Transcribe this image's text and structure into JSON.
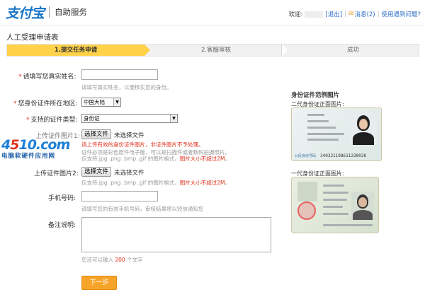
{
  "header": {
    "logo": "支付宝",
    "title": "自助服务",
    "welcome": "欢迎:",
    "logout": "[退出]",
    "messages": "消息(2)",
    "help": "使用遇到问题?"
  },
  "page": {
    "title": "人工受理申请表"
  },
  "steps": [
    {
      "label": "1.提交任务申请"
    },
    {
      "label": "2.客服审核"
    },
    {
      "label": "成功"
    }
  ],
  "form": {
    "name_label": "请填写您真实姓名:",
    "name_hint": "请填写真实姓名，以便核实您的身份。",
    "region_label": "您身份证件所在地区:",
    "region_value": "中国大陆",
    "cert_type_label": "支持的证件类型:",
    "cert_type_value": "身份证",
    "upload1_label": "上传证件图片1:",
    "upload_button": "选择文件",
    "no_file": "未选择文件",
    "upload1_hint_red": "请上传有效的身份证件图片，非证件图片不予处理。",
    "upload1_hint_2": "证件必须是彩色原件电子版，可以是扫描件或者数码拍摄照片。",
    "upload1_hint_3_prefix": "仅支持.jpg .png .bmp .gif 的图片格式，",
    "size_limit": "图片大小不超过2M",
    "upload2_label": "上传证件图片2:",
    "upload2_hint_prefix": "仅支持.jpg .png .bmp .gif 的图片格式，",
    "phone_label": "手机号码:",
    "phone_hint": "请填写您的有效手机号码，审核结果将以短信通知您",
    "remark_label": "备注说明:",
    "remark_hint_prefix": "您还可以输入",
    "remark_count": "200",
    "remark_hint_suffix": "个文字",
    "next_button": "下一步"
  },
  "samples": {
    "title": "身份证件范例图片",
    "second_gen": "二代身份证正面图片:",
    "first_gen": "一代身份证正面图片:",
    "id_number": "340321198611230028"
  },
  "watermark": {
    "logo": "4510.com",
    "subtitle": "电脑软硬件应用网"
  }
}
